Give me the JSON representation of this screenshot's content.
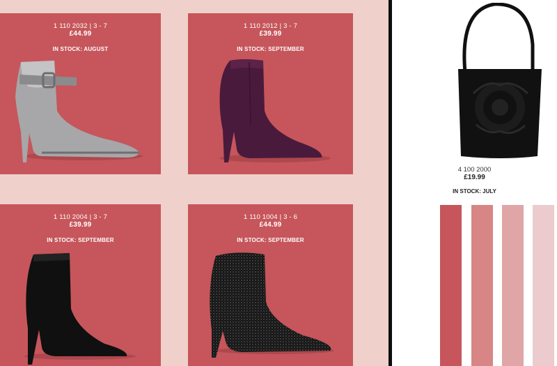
{
  "colors": {
    "background_pink": "#efd0cb",
    "card_red": "#c6565b",
    "divider": "#0d0d0d"
  },
  "products": [
    {
      "code": "1 110 2032 | 3 - 7",
      "price": "£44.99",
      "stock": "IN STOCK: AUGUST",
      "item": "silver ankle boot with buckle strap"
    },
    {
      "code": "1 110 2012 | 3 - 7",
      "price": "£39.99",
      "stock": "IN STOCK: SEPTEMBER",
      "item": "burgundy suede ankle boot"
    },
    {
      "code": "1 110 2004 | 3 - 7",
      "price": "£39.99",
      "stock": "IN STOCK: SEPTEMBER",
      "item": "black suede ankle boot"
    },
    {
      "code": "1 110 1004 | 3 - 6",
      "price": "£44.99",
      "stock": "IN STOCK: SEPTEMBER",
      "item": "black diamante ankle boot"
    }
  ],
  "bag": {
    "code": "4 100 2000",
    "price": "£19.99",
    "stock": "IN STOCK: JULY",
    "item": "black rose handbag"
  },
  "swatches": [
    "#c6565b",
    "#d78585",
    "#dfa5a7",
    "#ebcbcd"
  ]
}
